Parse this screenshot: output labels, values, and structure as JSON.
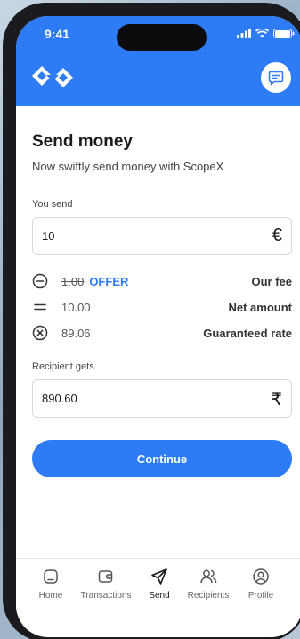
{
  "status": {
    "time": "9:41"
  },
  "header": {
    "logo": "scopex-logo",
    "chat_icon": "chat-icon"
  },
  "page": {
    "title": "Send money",
    "subtitle": "Now swiftly send money with ScopeX"
  },
  "send": {
    "label": "You send",
    "value": "10",
    "currency_symbol": "€"
  },
  "breakdown": [
    {
      "icon": "minus-circle-icon",
      "value": "1.00",
      "badge": "OFFER",
      "label": "Our fee"
    },
    {
      "icon": "equals-icon",
      "value": "10.00",
      "label": "Net amount"
    },
    {
      "icon": "times-circle-icon",
      "value": "89.06",
      "label": "Guaranteed rate"
    }
  ],
  "receive": {
    "label": "Recipient gets",
    "value": "890.60",
    "currency_symbol": "₹"
  },
  "continue_label": "Continue",
  "tabs": [
    {
      "label": "Home",
      "icon": "home-icon",
      "active": false
    },
    {
      "label": "Transactions",
      "icon": "wallet-icon",
      "active": false
    },
    {
      "label": "Send",
      "icon": "send-icon",
      "active": true
    },
    {
      "label": "Recipients",
      "icon": "recipients-icon",
      "active": false
    },
    {
      "label": "Profile",
      "icon": "profile-icon",
      "active": false
    }
  ],
  "colors": {
    "accent": "#2d7cf6",
    "text": "#1a1a1a"
  }
}
